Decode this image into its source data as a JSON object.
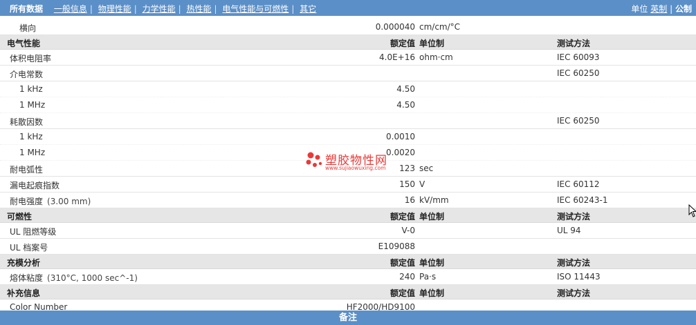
{
  "nav": {
    "tabs": [
      {
        "label": "所有数据",
        "active": true
      },
      {
        "label": "一般信息"
      },
      {
        "label": "物理性能"
      },
      {
        "label": "力学性能"
      },
      {
        "label": "热性能"
      },
      {
        "label": "电气性能与可燃性"
      },
      {
        "label": "其它"
      }
    ],
    "units_label": "单位",
    "units": [
      {
        "label": "英制",
        "active": false
      },
      {
        "label": "公制",
        "active": true
      }
    ],
    "units_sep": "|"
  },
  "rows": [
    {
      "type": "item",
      "name": "横向",
      "indent": true,
      "value": "0.000040",
      "unit": "cm/cm/°C",
      "test": ""
    },
    {
      "type": "header",
      "name": "电气性能",
      "value": "额定值",
      "unit": "单位制",
      "test": "测试方法"
    },
    {
      "type": "item",
      "name": "体积电阻率",
      "value": "4.0E+16",
      "unit": "ohm·cm",
      "test": "IEC 60093"
    },
    {
      "type": "item",
      "name": "介电常数",
      "value": "",
      "unit": "",
      "test": "IEC 60250"
    },
    {
      "type": "sub",
      "name": "1 kHz",
      "value": "4.50",
      "unit": "",
      "test": ""
    },
    {
      "type": "sub",
      "name": "1 MHz",
      "value": "4.50",
      "unit": "",
      "test": ""
    },
    {
      "type": "item",
      "name": "耗散因数",
      "value": "",
      "unit": "",
      "test": "IEC 60250"
    },
    {
      "type": "sub",
      "name": "1 kHz",
      "value": "0.0010",
      "unit": "",
      "test": ""
    },
    {
      "type": "sub",
      "name": "1 MHz",
      "value": "0.0020",
      "unit": "",
      "test": ""
    },
    {
      "type": "item",
      "name": "耐电弧性",
      "value": "123",
      "unit": "sec",
      "test": ""
    },
    {
      "type": "item",
      "name": "漏电起痕指数",
      "value": "150",
      "unit": "V",
      "test": "IEC 60112"
    },
    {
      "type": "item",
      "name": "耐电强度",
      "cond": "(3.00 mm)",
      "value": "16",
      "unit": "kV/mm",
      "test": "IEC 60243-1"
    },
    {
      "type": "header",
      "name": "可燃性",
      "value": "额定值",
      "unit": "单位制",
      "test": "测试方法"
    },
    {
      "type": "item",
      "name": "UL 阻燃等级",
      "value": "V-0",
      "unit": "",
      "test": "UL 94"
    },
    {
      "type": "item",
      "name": "UL 档案号",
      "value": "E109088",
      "unit": "",
      "test": ""
    },
    {
      "type": "header",
      "name": "充模分析",
      "value": "额定值",
      "unit": "单位制",
      "test": "测试方法"
    },
    {
      "type": "item",
      "name": "熔体粘度",
      "cond": "(310°C, 1000 sec^-1)",
      "value": "240",
      "unit": "Pa·s",
      "test": "ISO 11443"
    },
    {
      "type": "header",
      "name": "补充信息",
      "value": "额定值",
      "unit": "单位制",
      "test": "测试方法"
    },
    {
      "type": "item",
      "name": "Color Number",
      "value": "HF2000/HD9100",
      "unit": "",
      "test": ""
    }
  ],
  "footer": {
    "label": "备注"
  },
  "watermark": {
    "title": "塑胶物性网",
    "url": "www.sujiaowuxing.com"
  },
  "colors": {
    "nav_bg": "#5b8fc7",
    "header_bg": "#e6e6e6",
    "watermark": "#e8302e"
  }
}
